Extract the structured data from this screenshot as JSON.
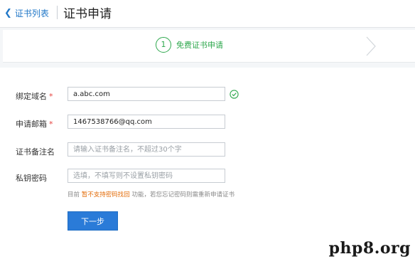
{
  "header": {
    "back_label": "证书列表",
    "title": "证书申请"
  },
  "steps": [
    {
      "number": "1",
      "label": "免费证书申请",
      "status": "active"
    }
  ],
  "form": {
    "domain": {
      "label": "绑定域名",
      "required_mark": "*",
      "value": "a.abc.com",
      "status_icon": "check-circle-icon"
    },
    "email": {
      "label": "申请邮箱",
      "required_mark": "*",
      "value": "1467538766@qq.com"
    },
    "note": {
      "label": "证书备注名",
      "value": "",
      "placeholder": "请输入证书备注名，不超过30个字"
    },
    "key_password": {
      "label": "私钥密码",
      "value": "",
      "placeholder": "选填，不填写则不设置私钥密码"
    },
    "hint": {
      "prefix": "目前",
      "highlight": "暂不支持密码找回",
      "suffix": "功能，若您忘记密码则需重新申请证书"
    },
    "next_button": "下一步"
  },
  "watermark": "php8.org",
  "colors": {
    "link_blue": "#2278c8",
    "step_green": "#2ea84d",
    "required_red": "#e64340",
    "warning_orange": "#e36c09",
    "button_blue": "#2a7bd8"
  }
}
